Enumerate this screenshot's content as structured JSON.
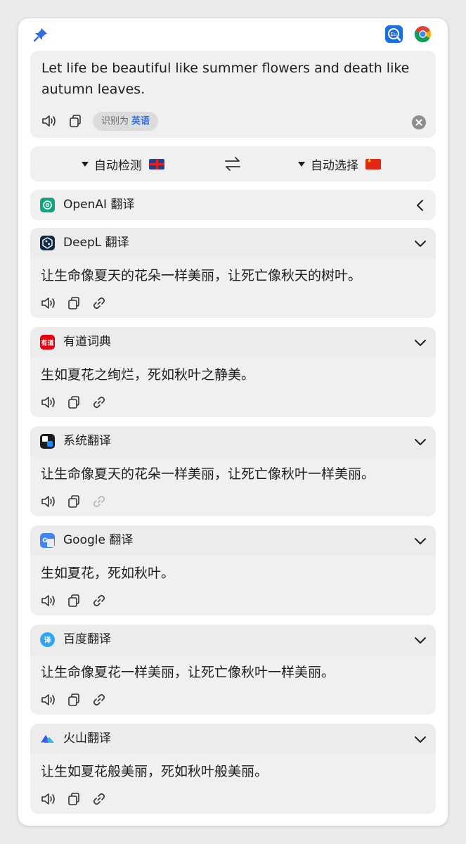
{
  "input": {
    "text": "Let life be beautiful like summer flowers and death like autumn leaves.",
    "detect_prefix": "识别为",
    "detect_lang": "英语"
  },
  "lang_bar": {
    "source": "自动检测",
    "target": "自动选择"
  },
  "services": [
    {
      "name": "OpenAI 翻译",
      "icon": "openai-icon",
      "expanded": false
    },
    {
      "name": "DeepL 翻译",
      "icon": "deepl-icon",
      "expanded": true,
      "result": "让生命像夏天的花朵一样美丽，让死亡像秋天的树叶。"
    },
    {
      "name": "有道词典",
      "icon": "youdao-icon",
      "icon_text": "有道",
      "expanded": true,
      "result": "生如夏花之绚烂，死如秋叶之静美。"
    },
    {
      "name": "系统翻译",
      "icon": "apple-translate-icon",
      "expanded": true,
      "result": "让生命像夏天的花朵一样美丽，让死亡像秋叶一样美丽。",
      "link_disabled": true
    },
    {
      "name": "Google 翻译",
      "icon": "google-translate-icon",
      "expanded": true,
      "result": "生如夏花，死如秋叶。"
    },
    {
      "name": "百度翻译",
      "icon": "baidu-translate-icon",
      "icon_text": "译",
      "expanded": true,
      "result": "让生命像夏花一样美丽，让死亡像秋叶一样美丽。"
    },
    {
      "name": "火山翻译",
      "icon": "volcano-translate-icon",
      "expanded": true,
      "result": "让生如夏花般美丽，死如秋叶般美丽。"
    }
  ],
  "colors": {
    "accent": "#2f6fe4",
    "pin": "#2f6fe4",
    "card_bg": "#f0f0f0",
    "youdao": "#e60012",
    "deepl": "#0f2b46",
    "openai": "#10a37f"
  }
}
